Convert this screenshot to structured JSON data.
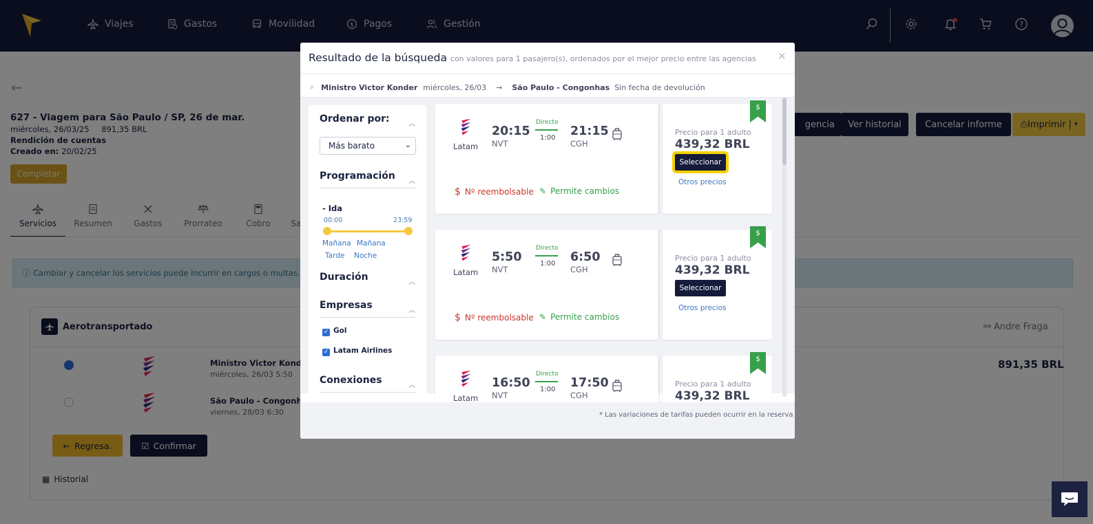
{
  "nav": {
    "items": [
      {
        "label": "Viajes",
        "icon": "plane-icon"
      },
      {
        "label": "Gastos",
        "icon": "receipt-icon"
      },
      {
        "label": "Movilidad",
        "icon": "car-icon"
      },
      {
        "label": "Pagos",
        "icon": "dollar-icon"
      },
      {
        "label": "Gestión",
        "icon": "users-icon"
      }
    ]
  },
  "trip": {
    "title": "627 - Viagem para São Paulo / SP, 26 de mar.",
    "date": "miércoles, 26/03/25",
    "total": "891,35 BRL",
    "kind": "Rendición de cuentas",
    "created_label": "Creado en:",
    "created_value": "20/02/25",
    "complete_button": "Completar"
  },
  "tabs": [
    "Servicios",
    "Resumen",
    "Gastos",
    "Prorrateo",
    "Cobro",
    "Sa"
  ],
  "alert": "Cambiar y cancelar los servicios puede incurrir en cargos o multas. Po",
  "actions": {
    "agencia": "gencia",
    "historial": "Ver historial",
    "cancelar": "Cancelar informe",
    "imprimir": "Imprimir |"
  },
  "service": {
    "title": "Aerotransportado",
    "user": "Andre Fraga",
    "legs": [
      {
        "name": "Ministro Victor Konder",
        "date": "miércoles, 26/03 5:50",
        "selected": true
      },
      {
        "name": "São Paulo - Congonhas",
        "date": "viernes, 28/03 6:30",
        "selected": false
      }
    ],
    "price": "891,35 BRL",
    "back_button": "Regresa.",
    "confirm_button": "Confirmar",
    "history_link": "Historial"
  },
  "modal": {
    "title": "Resultado de la búsqueda",
    "subtitle": "con valores para 1 pasajero(s), ordenados por el mejor precio entre las agencias",
    "close": "×",
    "route": {
      "origin": "Ministro Victor Konder",
      "date": "miércoles, 26/03",
      "arrow": "→",
      "destination": "São Paulo - Congonhas",
      "return": "Sin fecha de devolución"
    },
    "filters": {
      "order_title": "Ordenar por:",
      "order_value": "Más barato",
      "schedule_title": "Programación",
      "ida": "- Ida",
      "time_from": "00:00",
      "time_to": "23:59",
      "slots": [
        "Mañana",
        "Mañana",
        "Tarde",
        "Noche"
      ],
      "duration_title": "Duración",
      "companies_title": "Empresas",
      "companies": [
        "Gol",
        "Latam Airlines"
      ],
      "connections_title": "Conexiones"
    },
    "flights": [
      {
        "airline": "Latam",
        "dep_time": "20:15",
        "dep_code": "NVT",
        "stops": "Directo",
        "duration": "1:00",
        "arr_time": "21:15",
        "arr_code": "CGH",
        "refund": "Nº reembolsable",
        "changes": "Permite cambios",
        "price_label": "Precio para 1 adulto",
        "price": "439,32 BRL",
        "select": "Seleccionar",
        "other": "Otros precios",
        "badge": "$"
      },
      {
        "airline": "Latam",
        "dep_time": "5:50",
        "dep_code": "NVT",
        "stops": "Directo",
        "duration": "1:00",
        "arr_time": "6:50",
        "arr_code": "CGH",
        "refund": "Nº reembolsable",
        "changes": "Permite cambios",
        "price_label": "Precio para 1 adulto",
        "price": "439,32 BRL",
        "select": "Seleccionar",
        "other": "Otros precios",
        "badge": "$"
      },
      {
        "airline": "Latam",
        "dep_time": "16:50",
        "dep_code": "NVT",
        "stops": "Directo",
        "duration": "1:00",
        "arr_time": "17:50",
        "arr_code": "CGH",
        "price_label": "Precio para 1 adulto",
        "price": "439,32 BRL",
        "badge": "$"
      }
    ],
    "disclaimer": "* Las variaciones de tarifas pueden ocurrir en la reserva"
  },
  "colors": {
    "nav": "#151b3a",
    "accent": "#f5c842",
    "green": "#37a04a",
    "red": "#c8372d",
    "link": "#3a76c2"
  }
}
